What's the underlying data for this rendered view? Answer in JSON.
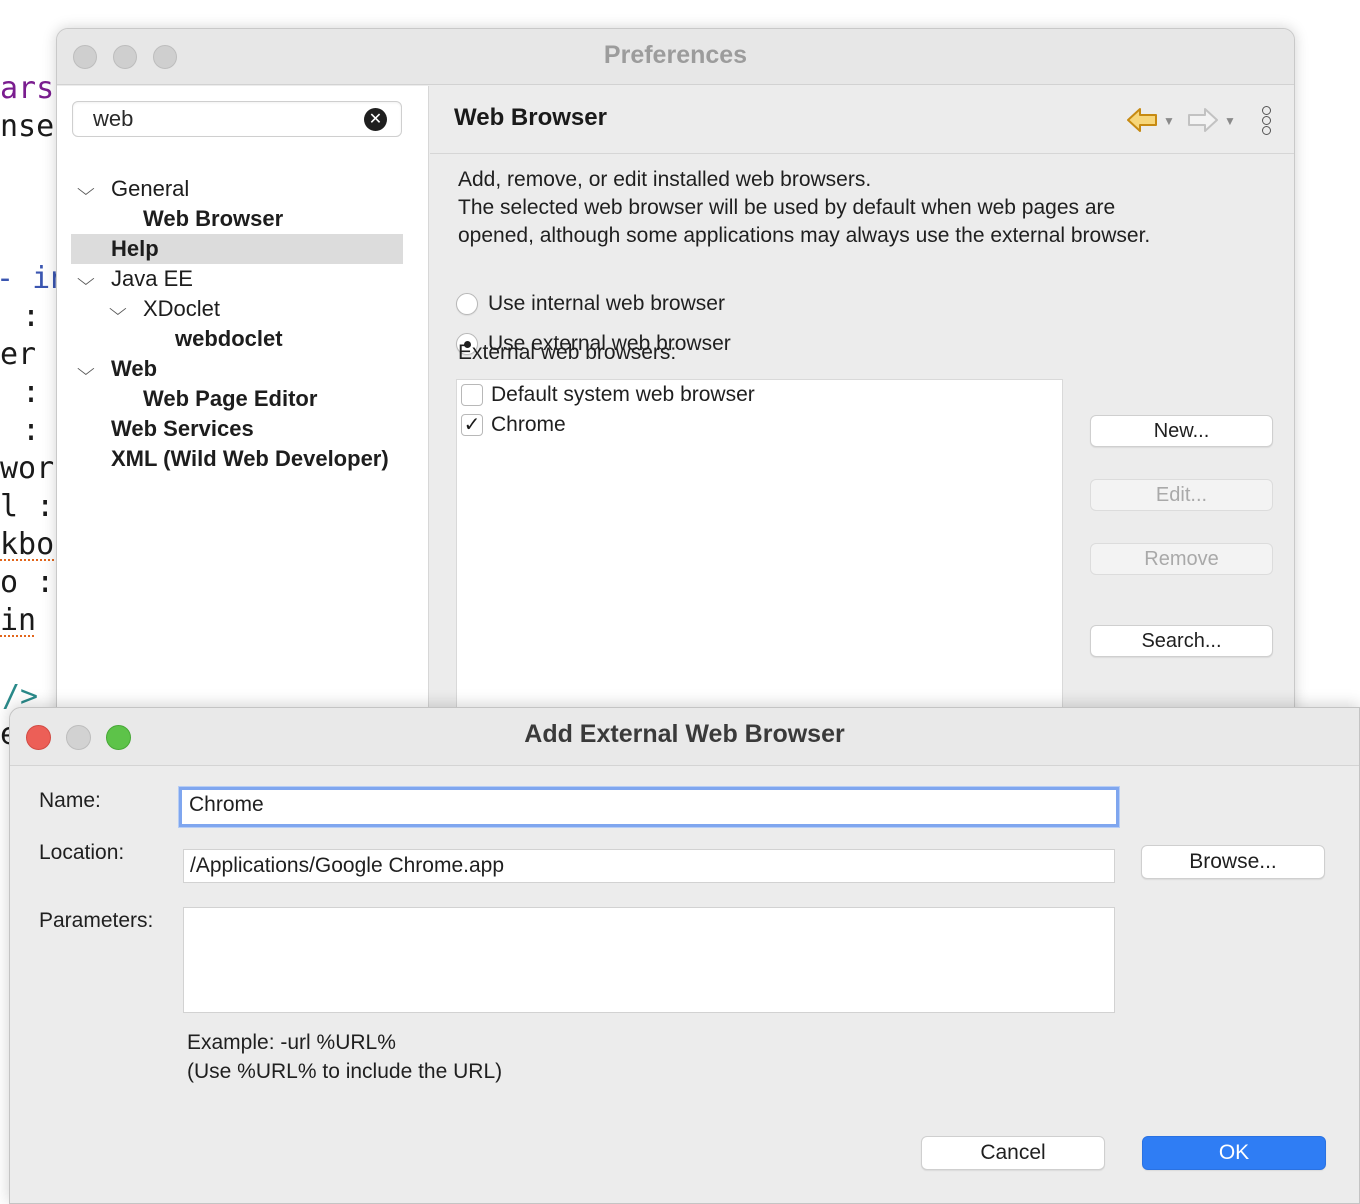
{
  "background_code": {
    "lines": [
      "ars",
      "nse",
      "- in",
      ":",
      "er",
      ":",
      ":",
      "wor",
      "l :",
      "kbo",
      "o :",
      "in",
      "/>",
      "e"
    ]
  },
  "preferences": {
    "title": "Preferences",
    "search": {
      "value": "web"
    },
    "tree": [
      {
        "label": "General",
        "expanded": true,
        "bold": false
      },
      {
        "label": "Web Browser",
        "selected": true,
        "bold": true
      },
      {
        "label": "Help",
        "bold": true
      },
      {
        "label": "Java EE",
        "expanded": true,
        "bold": false
      },
      {
        "label": "XDoclet",
        "expanded": true,
        "bold": false
      },
      {
        "label": "webdoclet",
        "bold": true
      },
      {
        "label": "Web",
        "expanded": true,
        "bold": true
      },
      {
        "label": "Web Page Editor",
        "bold": true
      },
      {
        "label": "Web Services",
        "bold": true
      },
      {
        "label": "XML (Wild Web Developer)",
        "bold": true
      }
    ],
    "page": {
      "title": "Web Browser",
      "back_icon": "back-arrow-icon",
      "forward_icon": "forward-arrow-icon",
      "menu_icon": "vertical-dots-icon",
      "description": [
        "Add, remove, or edit installed web browsers.",
        "The selected web browser will be used by default when web pages are",
        "opened, although some applications may always use the external browser."
      ],
      "radio_internal": "Use internal web browser",
      "radio_external": "Use external web browser",
      "radio_selected": "external",
      "external_label": "External web browsers:",
      "browsers": [
        {
          "label": "Default system web browser",
          "checked": false
        },
        {
          "label": "Chrome",
          "checked": true
        }
      ],
      "buttons": {
        "new": "New...",
        "edit": "Edit...",
        "remove": "Remove",
        "search": "Search..."
      }
    }
  },
  "dialog": {
    "title": "Add External Web Browser",
    "name_label": "Name:",
    "name_value": "Chrome",
    "location_label": "Location:",
    "location_value": "/Applications/Google Chrome.app",
    "browse_button": "Browse...",
    "parameters_label": "Parameters:",
    "parameters_value": "",
    "hint_line1": "Example: -url %URL%",
    "hint_line2": "(Use %URL% to include the URL)",
    "cancel_button": "Cancel",
    "ok_button": "OK"
  },
  "colors": {
    "accent": "#2f7df4",
    "focus_ring": "#7fa6ef",
    "close_red": "#ec5f57",
    "maximize_green": "#5dc349",
    "back_arrow": "#c78a12"
  }
}
